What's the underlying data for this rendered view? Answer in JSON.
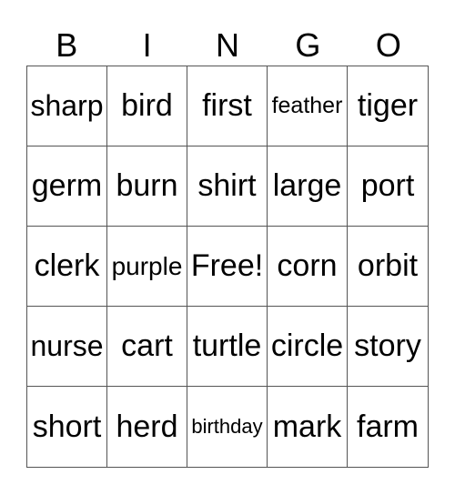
{
  "header": [
    "B",
    "I",
    "N",
    "G",
    "O"
  ],
  "cells": [
    "sharp",
    "bird",
    "first",
    "feather",
    "tiger",
    "germ",
    "burn",
    "shirt",
    "large",
    "port",
    "clerk",
    "purple",
    "Free!",
    "corn",
    "orbit",
    "nurse",
    "cart",
    "turtle",
    "circle",
    "story",
    "short",
    "herd",
    "birthday",
    "mark",
    "farm"
  ]
}
